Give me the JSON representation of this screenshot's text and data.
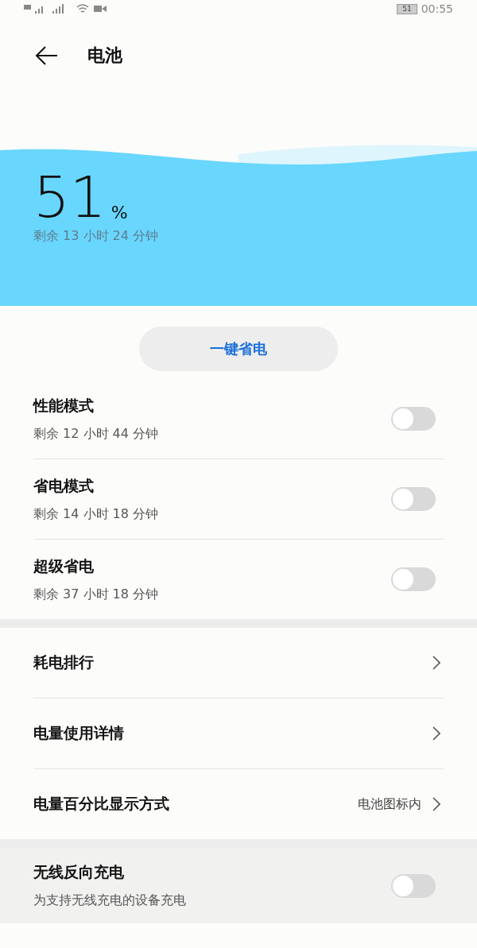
{
  "status_bar": {
    "battery": "51",
    "time": "00:55"
  },
  "header": {
    "title": "电池"
  },
  "battery": {
    "percent": "51",
    "percent_sign": "%",
    "remaining": "剩余 13 小时 24 分钟"
  },
  "one_tap_button": "一键省电",
  "modes": [
    {
      "title": "性能模式",
      "subtitle": "剩余 12 小时 44 分钟",
      "on": false
    },
    {
      "title": "省电模式",
      "subtitle": "剩余 14 小时 18 分钟",
      "on": false
    },
    {
      "title": "超级省电",
      "subtitle": "剩余 37 小时 18 分钟",
      "on": false
    }
  ],
  "links": [
    {
      "kind": "link",
      "title": "耗电排行"
    },
    {
      "kind": "link",
      "title": "电量使用详情"
    },
    {
      "kind": "value",
      "title": "电量百分比显示方式",
      "value": "电池图标内"
    }
  ],
  "reverse_charging": {
    "title": "无线反向充电",
    "subtitle": "为支持无线充电的设备充电",
    "on": false
  }
}
